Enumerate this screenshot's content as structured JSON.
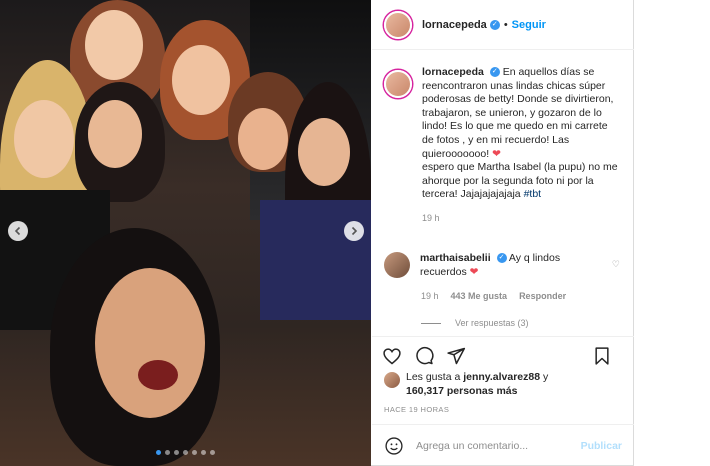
{
  "post": {
    "author": "lornacepeda",
    "follow_label": "Seguir",
    "separator": "•",
    "caption": {
      "username": "lornacepeda",
      "line1": "En aquellos días se reencontraron unas lindas chicas súper poderosas de betty! Donde se divirtieron, trabajaron, se unieron, y gozaron de lo lindo! Es lo que me quedo en mi carrete de fotos , y en mi recuerdo! Las quierooooooo!",
      "line2": "espero que Martha Isabel (la pupu) no me ahorque por la segunda foto ni por la tercera! Jajajajajajaja",
      "hashtag": "#tbt",
      "time": "19 h"
    },
    "comment": {
      "username": "marthaisabelii",
      "text": "Ay q lindos recuerdos",
      "time": "19 h",
      "likes": "443 Me gusta",
      "reply_label": "Responder",
      "view_replies": "Ver respuestas (3)"
    },
    "likes": {
      "prefix": "Les gusta a",
      "liker": "jenny.alvarez88",
      "joiner": "y",
      "count": "160,317 personas más"
    },
    "age": "HACE 19 HORAS",
    "add_comment": {
      "placeholder": "Agrega un comentario...",
      "publish_label": "Publicar"
    },
    "carousel": {
      "total": 7,
      "active": 0
    }
  },
  "colors": {
    "accent": "#0095f6",
    "verified": "#3897f0",
    "heart": "#ed4956",
    "muted": "#8e8e8e",
    "publish_disabled": "#b2dffc"
  },
  "icons": {
    "verified": "verified-badge-icon",
    "like": "heart-icon",
    "comment": "speech-bubble-icon",
    "share": "paper-plane-icon",
    "save": "bookmark-icon",
    "emoji": "smiley-icon",
    "prev": "chevron-left-icon",
    "next": "chevron-right-icon"
  }
}
